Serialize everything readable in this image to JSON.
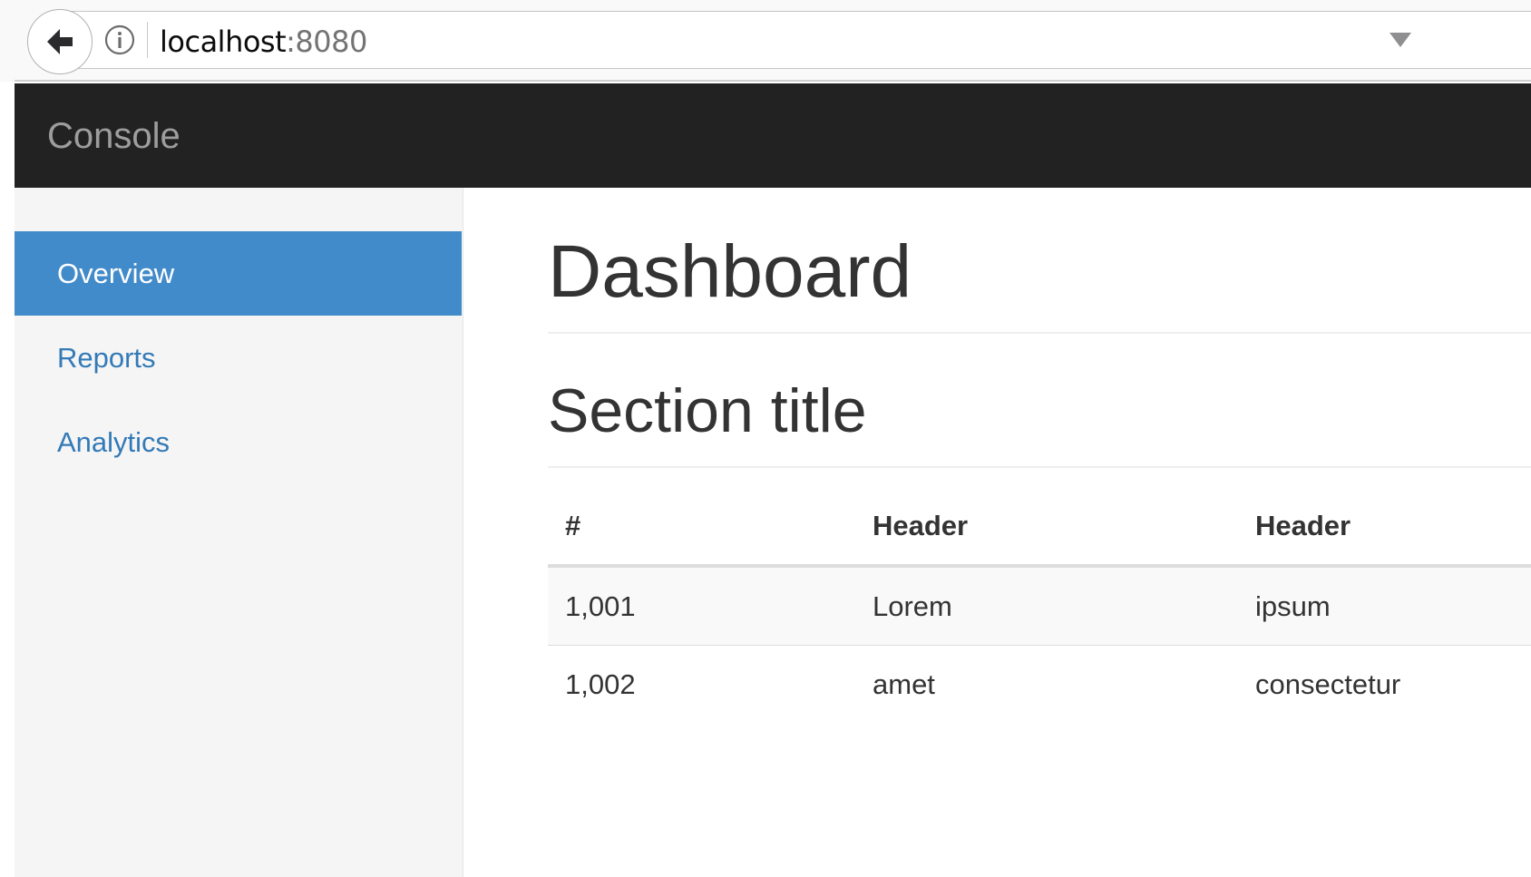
{
  "browser": {
    "url_host": "localhost",
    "url_port": ":8080"
  },
  "navbar": {
    "brand": "Console"
  },
  "sidebar": {
    "items": [
      {
        "label": "Overview",
        "active": true
      },
      {
        "label": "Reports",
        "active": false
      },
      {
        "label": "Analytics",
        "active": false
      }
    ]
  },
  "main": {
    "page_title": "Dashboard",
    "section_title": "Section title",
    "table": {
      "headers": [
        "#",
        "Header",
        "Header"
      ],
      "rows": [
        [
          "1,001",
          "Lorem",
          "ipsum"
        ],
        [
          "1,002",
          "amet",
          "consectetur"
        ]
      ]
    }
  },
  "colors": {
    "navbar_bg": "#222222",
    "active_nav_bg": "#428bca",
    "link": "#337ab7"
  }
}
